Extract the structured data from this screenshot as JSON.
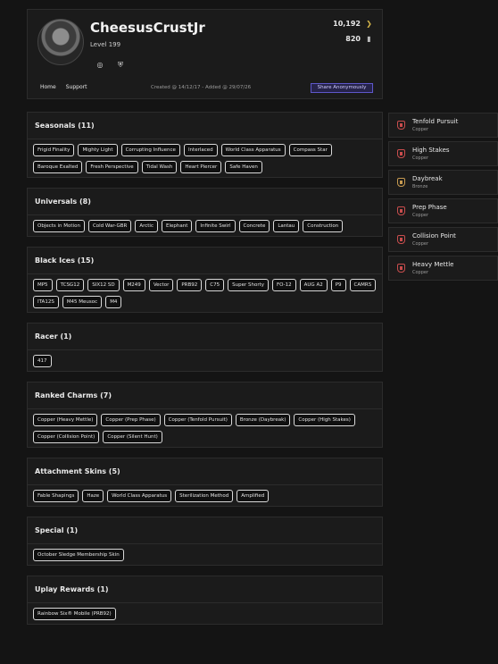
{
  "profile": {
    "username": "CheesusCrustJr",
    "level": "Level 199",
    "renown": "10,192",
    "credits": "820",
    "icons": [
      "target-icon",
      "shield-icon"
    ],
    "nav": [
      "Home",
      "Support"
    ],
    "dates": "Created @ 14/12/17 - Added @ 29/07/26",
    "share_label": "Share Anonymously"
  },
  "sections": [
    {
      "title": "Seasonals (11)",
      "items": [
        "Frigid Finality",
        "Mighty Light",
        "Corrupting Influence",
        "Interlaced",
        "World Class Apparatus",
        "Compass Star",
        "Baroque Exalted",
        "Fresh Perspective",
        "Tidal Wash",
        "Heart Piercer",
        "Safe Haven"
      ]
    },
    {
      "title": "Universals (8)",
      "items": [
        "Objects in Motion",
        "Cold War-GBR",
        "Arctic",
        "Elephant",
        "Infinite Swirl",
        "Concrete",
        "Lantau",
        "Construction"
      ]
    },
    {
      "title": "Black Ices (15)",
      "items": [
        "MP5",
        "TCSG12",
        "SIX12 SD",
        "M249",
        "Vector",
        "PRB92",
        "C75",
        "Super Shorty",
        "FO-12",
        "AUG A2",
        "P9",
        "CAMRS",
        "ITA12S",
        "M45 Meusoc",
        "M4"
      ]
    },
    {
      "title": "Racer (1)",
      "items": [
        "417"
      ]
    },
    {
      "title": "Ranked Charms (7)",
      "items": [
        "Copper (Heavy Mettle)",
        "Copper (Prep Phase)",
        "Copper (Tenfold Pursuit)",
        "Bronze (Daybreak)",
        "Copper (High Stakes)",
        "Copper (Collision Point)",
        "Copper (Silent Hunt)"
      ]
    },
    {
      "title": "Attachment Skins (5)",
      "items": [
        "Fable Shapings",
        "Haze",
        "World Class Apparatus",
        "Sterilization Method",
        "Amplified"
      ]
    },
    {
      "title": "Special (1)",
      "items": [
        "October Sledge Membership Skin"
      ]
    },
    {
      "title": "Uplay Rewards (1)",
      "items": [
        "Rainbow Six® Mobile (PRB92)"
      ]
    }
  ],
  "sidebar": [
    {
      "name": "Tenfold Pursuit",
      "tier": "Copper",
      "color": "#c94d4d"
    },
    {
      "name": "High Stakes",
      "tier": "Copper",
      "color": "#c94d4d"
    },
    {
      "name": "Daybreak",
      "tier": "Bronze",
      "color": "#c79a50"
    },
    {
      "name": "Prep Phase",
      "tier": "Copper",
      "color": "#c94d4d"
    },
    {
      "name": "Collision Point",
      "tier": "Copper",
      "color": "#c94d4d"
    },
    {
      "name": "Heavy Mettle",
      "tier": "Copper",
      "color": "#c94d4d"
    }
  ],
  "colors": {
    "background": "#141414",
    "panel": "#1b1b1b",
    "accent": "#5e57c9"
  }
}
